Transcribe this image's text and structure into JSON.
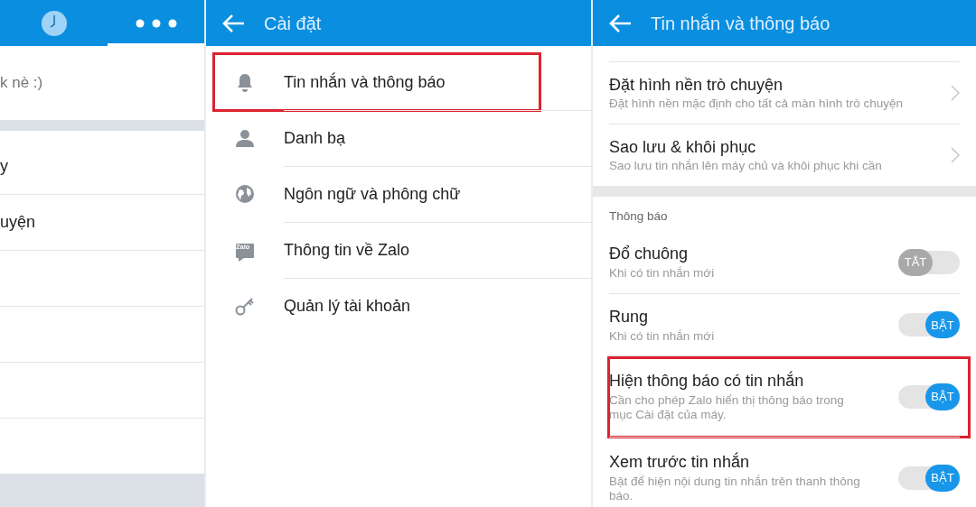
{
  "chat_list_panel": {
    "tabs": [
      {
        "kind": "clock",
        "selected": false
      },
      {
        "kind": "more",
        "selected": true
      }
    ],
    "status_text": "k nè :)",
    "items": [
      "y",
      "uyện"
    ]
  },
  "settings": {
    "title": "Cài đặt",
    "items": [
      {
        "label": "Tin nhắn và thông báo",
        "highlighted": true
      },
      {
        "label": "Danh bạ",
        "highlighted": false
      },
      {
        "label": "Ngôn ngữ và phông chữ",
        "highlighted": false
      },
      {
        "logo_text": "Zalo",
        "label": "Thông tin về Zalo",
        "highlighted": false
      },
      {
        "label": "Quản lý tài khoản",
        "highlighted": false
      }
    ]
  },
  "messages_settings": {
    "title": "Tin nhắn và thông báo",
    "nav_items": [
      {
        "title": "Đặt hình nền trò chuyện",
        "subtitle": "Đặt hình nền mặc định cho tất cả màn hình trò chuyện"
      },
      {
        "title": "Sao lưu & khôi phục",
        "subtitle": "Sao lưu tin nhắn lên máy chủ và khôi phục khi cần"
      }
    ],
    "section_label": "Thông báo",
    "toggles": [
      {
        "title": "Đổ chuông",
        "subtitle": "Khi có tin nhắn mới",
        "on": false,
        "state_label": "TẮT",
        "highlighted": false
      },
      {
        "title": "Rung",
        "subtitle": "Khi có tin nhắn mới",
        "on": true,
        "state_label": "BẬT",
        "highlighted": false
      },
      {
        "title": "Hiện thông báo có tin nhắn",
        "subtitle": "Cần cho phép Zalo hiển thị thông báo trong mục Cài đặt của máy.",
        "on": true,
        "state_label": "BẬT",
        "highlighted": true
      },
      {
        "title": "Xem trước tin nhắn",
        "subtitle": "Bật để hiện nội dung tin nhắn trên thanh thông báo.",
        "on": true,
        "state_label": "BẬT",
        "highlighted": false
      }
    ]
  }
}
